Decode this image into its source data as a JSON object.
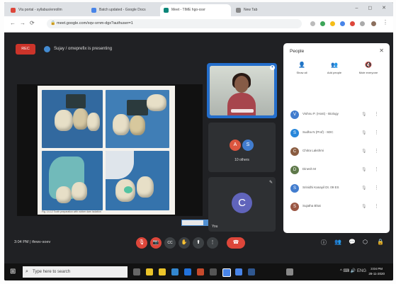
{
  "browser": {
    "tabs": [
      {
        "label": "Vtu portal - syllabus/enrollm",
        "favicon": "#ea4335"
      },
      {
        "label": "Batch updated - Google Docs",
        "favicon": "#4285f4"
      },
      {
        "label": "Meet - TIME hgo-xsvr",
        "favicon": "#00897b"
      },
      {
        "label": "New Tab",
        "favicon": "#888888"
      }
    ],
    "url": "meet.google.com/xqv-srnm-dgx?authuser=1",
    "window_controls": "– ◻ ✕"
  },
  "meet": {
    "record_badge": "REC",
    "presenting_text": "Sujay / omeprefix is presenting",
    "slide_caption": "Fig. 14-12 Tooth preparation with rubber dam isolation",
    "others_label": "10 others",
    "others_avatars": [
      {
        "initial": "A",
        "color": "#e8533a"
      },
      {
        "initial": "S",
        "color": "#3b7dd8"
      }
    ],
    "speaker_tile": {
      "initial": "C",
      "name": "You"
    },
    "clock": "3:04 PM  |  tfewv-soev",
    "controls": {
      "mic": "🎙",
      "camera": "📷",
      "captions": "CC",
      "raise_hand": "✋",
      "present": "⬆",
      "more": "⋮",
      "end_call": "☎"
    },
    "right_controls": [
      "ⓘ",
      "👥",
      "💬",
      "⬡",
      "🔒"
    ]
  },
  "people": {
    "title": "People",
    "close": "✕",
    "actions": [
      {
        "icon": "👤",
        "label": "Show all"
      },
      {
        "icon": "👥",
        "label": "Add people"
      },
      {
        "icon": "🔇",
        "label": "Mute everyone"
      }
    ],
    "participants": [
      {
        "name": "Vishnu P. (Host) - Biology",
        "color": "#3b7dd8",
        "initial": "V"
      },
      {
        "name": "Sudha N (Prof) - SDC",
        "color": "#1e88e5",
        "initial": "S"
      },
      {
        "name": "Chitra Lakshmi",
        "color": "#8e5b3c",
        "initial": "C"
      },
      {
        "name": "Dinesh M",
        "color": "#5d7a46",
        "initial": "D"
      },
      {
        "name": "Srinidhi Kanayil Dt. 09 ES",
        "color": "#3b7dd8",
        "initial": "S"
      },
      {
        "name": "Sujatha Bhat",
        "color": "#a0553f",
        "initial": "S"
      }
    ]
  },
  "taskbar": {
    "start": "⊞",
    "search_placeholder": "Type here to search",
    "tray": "^ ⌨ 🔊 ENG",
    "time": "3:04 PM",
    "date": "28-11-2020"
  }
}
